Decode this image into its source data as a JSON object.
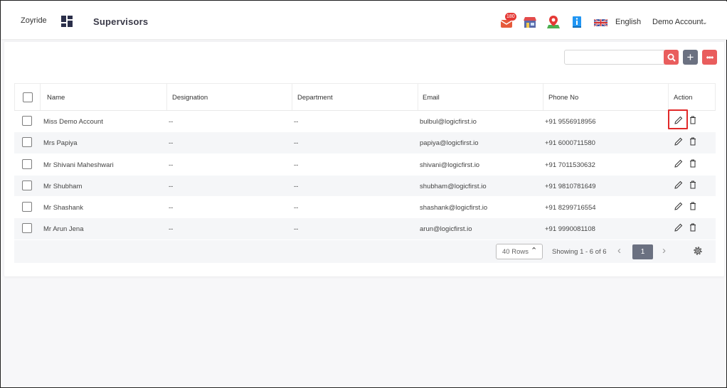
{
  "header": {
    "brand": "Zoyride",
    "title": "Supervisors",
    "notification_count": "180",
    "language": "English",
    "account": "Demo Account",
    "icons": [
      "dashboard-grid-icon",
      "notifications-icon",
      "shop-icon",
      "map-pin-icon",
      "info-book-icon",
      "uk-flag-icon",
      "chevron-down-icon"
    ]
  },
  "toolbar": {
    "search_placeholder": "",
    "icons": [
      "search-icon",
      "add-icon",
      "more-icon"
    ]
  },
  "table": {
    "columns": [
      "Name",
      "Designation",
      "Department",
      "Email",
      "Phone No",
      "Action"
    ],
    "rows": [
      {
        "name": "Miss Demo Account",
        "designation": "--",
        "department": "--",
        "email": "bulbul@logicfirst.io",
        "phone": "+91 9556918956"
      },
      {
        "name": "Mrs Papiya",
        "designation": "--",
        "department": "--",
        "email": "papiya@logicfirst.io",
        "phone": "+91 6000711580"
      },
      {
        "name": "Mr Shivani Maheshwari",
        "designation": "--",
        "department": "--",
        "email": "shivani@logicfirst.io",
        "phone": "+91 7011530632"
      },
      {
        "name": "Mr Shubham",
        "designation": "--",
        "department": "--",
        "email": "shubham@logicfirst.io",
        "phone": "+91 9810781649"
      },
      {
        "name": "Mr Shashank",
        "designation": "--",
        "department": "--",
        "email": "shashank@logicfirst.io",
        "phone": "+91 8299716554"
      },
      {
        "name": "Mr Arun Jena",
        "designation": "--",
        "department": "--",
        "email": "arun@logicfirst.io",
        "phone": "+91 9990081108"
      }
    ]
  },
  "pagination": {
    "rows_per_page": "40 Rows",
    "showing": "Showing  1 - 6 of 6",
    "current_page": "1"
  },
  "colors": {
    "accent_red": "#e95d5d",
    "slate": "#6b7181",
    "highlight": "#e12929"
  }
}
